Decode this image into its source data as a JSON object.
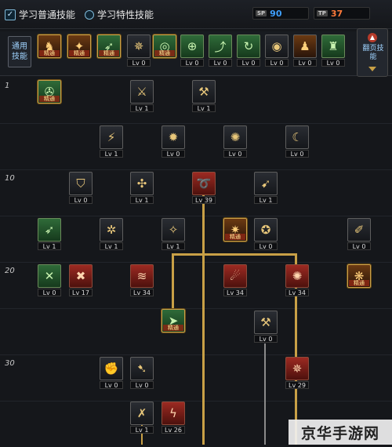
{
  "header": {
    "option_normal": "学习普通技能",
    "option_special": "学习特性技能",
    "sp_label": "SP",
    "sp_value": "90",
    "tp_label": "TP",
    "tp_value": "37",
    "sp_color": "#3fa0ff",
    "tp_color": "#ff7a3a"
  },
  "common_skills": {
    "label": "通用技能",
    "items": [
      {
        "lv": "精通"
      },
      {
        "lv": "精通"
      },
      {
        "lv": "精通"
      },
      {
        "lv": "Lv 0"
      },
      {
        "lv": "精通"
      },
      {
        "lv": "Lv 0"
      },
      {
        "lv": "Lv 0"
      },
      {
        "lv": "Lv 0"
      },
      {
        "lv": "Lv 0"
      },
      {
        "lv": "Lv 0"
      },
      {
        "lv": "Lv 0"
      }
    ]
  },
  "flip_panel": {
    "label": "翻页技能"
  },
  "rows": [
    {
      "label": "1"
    },
    {
      "label": ""
    },
    {
      "label": "10"
    },
    {
      "label": ""
    },
    {
      "label": "20"
    },
    {
      "label": ""
    },
    {
      "label": "30"
    },
    {
      "label": ""
    }
  ],
  "skills": [
    {
      "lv": "精通"
    },
    {
      "lv": "Lv 1"
    },
    {
      "lv": "Lv 1"
    },
    {
      "lv": "Lv 1"
    },
    {
      "lv": "Lv 0"
    },
    {
      "lv": "Lv 0"
    },
    {
      "lv": "Lv 0"
    },
    {
      "lv": "Lv 0"
    },
    {
      "lv": "Lv 1"
    },
    {
      "lv": "Lv 39"
    },
    {
      "lv": "Lv 1"
    },
    {
      "lv": "Lv 1"
    },
    {
      "lv": "Lv 1"
    },
    {
      "lv": "Lv 1"
    },
    {
      "lv": "精通"
    },
    {
      "lv": "Lv 0"
    },
    {
      "lv": "Lv 0"
    },
    {
      "lv": "Lv 0"
    },
    {
      "lv": "Lv 17"
    },
    {
      "lv": "Lv 34"
    },
    {
      "lv": "Lv 34"
    },
    {
      "lv": "Lv 34"
    },
    {
      "lv": "精通"
    },
    {
      "lv": "精通"
    },
    {
      "lv": "Lv 0"
    },
    {
      "lv": "Lv 0"
    },
    {
      "lv": "Lv 0"
    },
    {
      "lv": "Lv 29"
    },
    {
      "lv": "Lv 1"
    },
    {
      "lv": "Lv 26"
    }
  ],
  "watermark": "京华手游网"
}
